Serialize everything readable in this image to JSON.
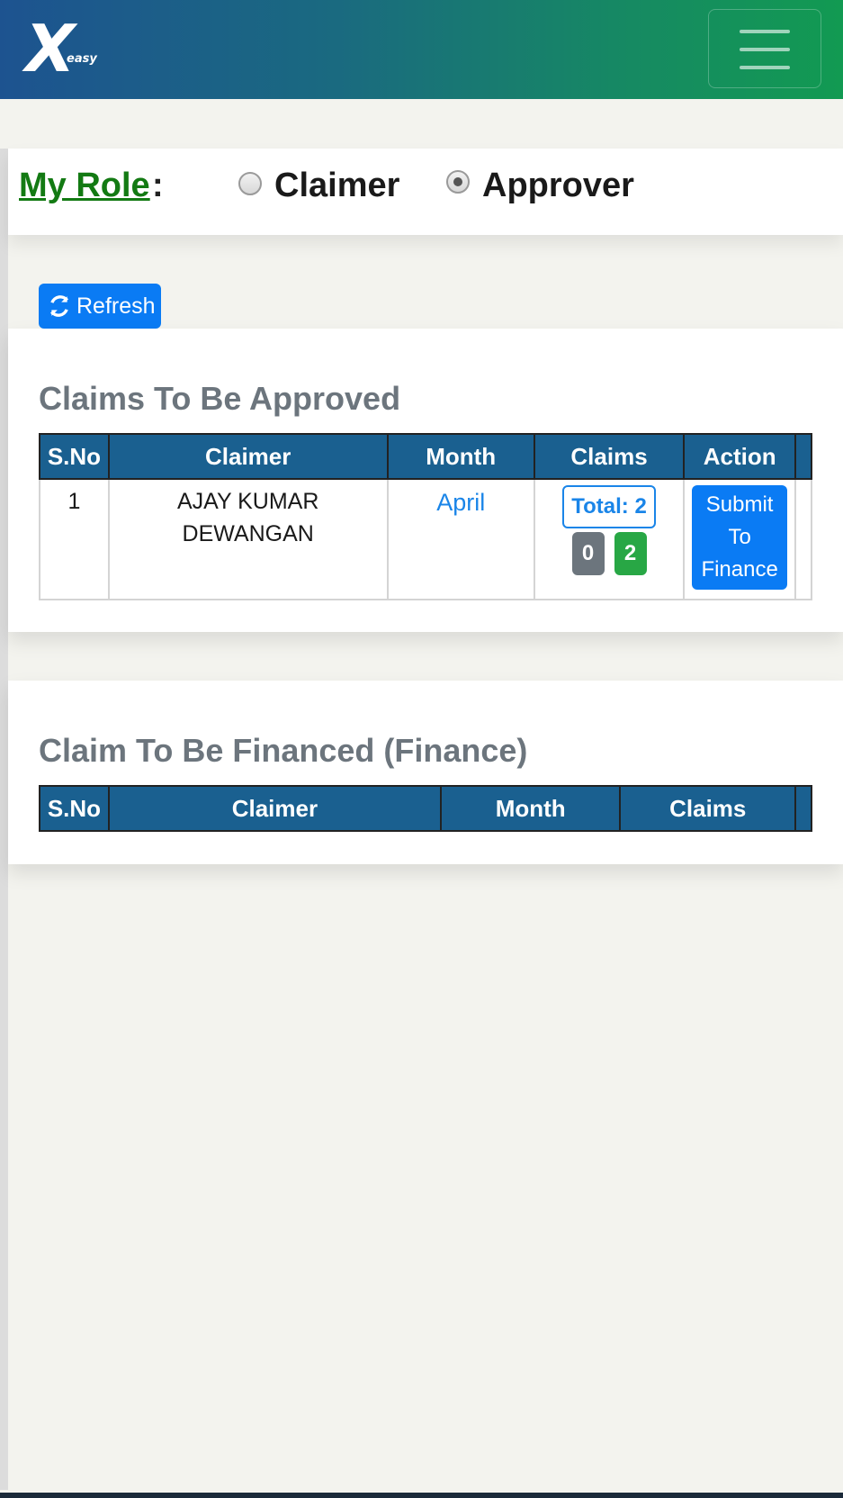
{
  "header": {
    "logo_mark": "X",
    "logo_sub": "easy",
    "menu_icon": "hamburger-menu-icon"
  },
  "role": {
    "label": "My Role",
    "colon": ":",
    "options": [
      {
        "label": "Claimer",
        "checked": false
      },
      {
        "label": "Approver",
        "checked": true
      }
    ]
  },
  "toolbar": {
    "refresh_label": "Refresh",
    "refresh_icon": "refresh-icon"
  },
  "approve_section": {
    "title": "Claims To Be Approved",
    "columns": [
      "S.No",
      "Claimer",
      "Month",
      "Claims",
      "Action"
    ],
    "rows": [
      {
        "sno": "1",
        "claimer": "AJAY KUMAR DEWANGAN",
        "month": "April",
        "total": "Total: 2",
        "pending": "0",
        "approved": "2",
        "action": "Submit To Finance"
      }
    ]
  },
  "finance_section": {
    "title": "Claim To Be Financed (Finance)",
    "columns": [
      "S.No",
      "Claimer",
      "Month",
      "Claims"
    ]
  },
  "colors": {
    "accent": "#0a7bf4",
    "header_bg": "#1a6090",
    "role_label": "#137a13",
    "badge_gray": "#6c757d",
    "badge_green": "#28a745"
  }
}
